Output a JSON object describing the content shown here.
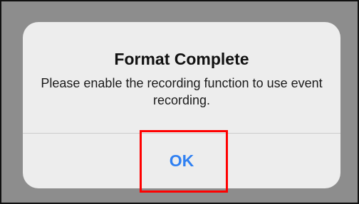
{
  "dialog": {
    "title": "Format Complete",
    "message": "Please enable the recording function to use event recording.",
    "button_label": "OK"
  },
  "colors": {
    "overlay": "#8d8d8d",
    "dialog_background": "#ededed",
    "button_text": "#2f80f2",
    "highlight": "#ff0000"
  }
}
